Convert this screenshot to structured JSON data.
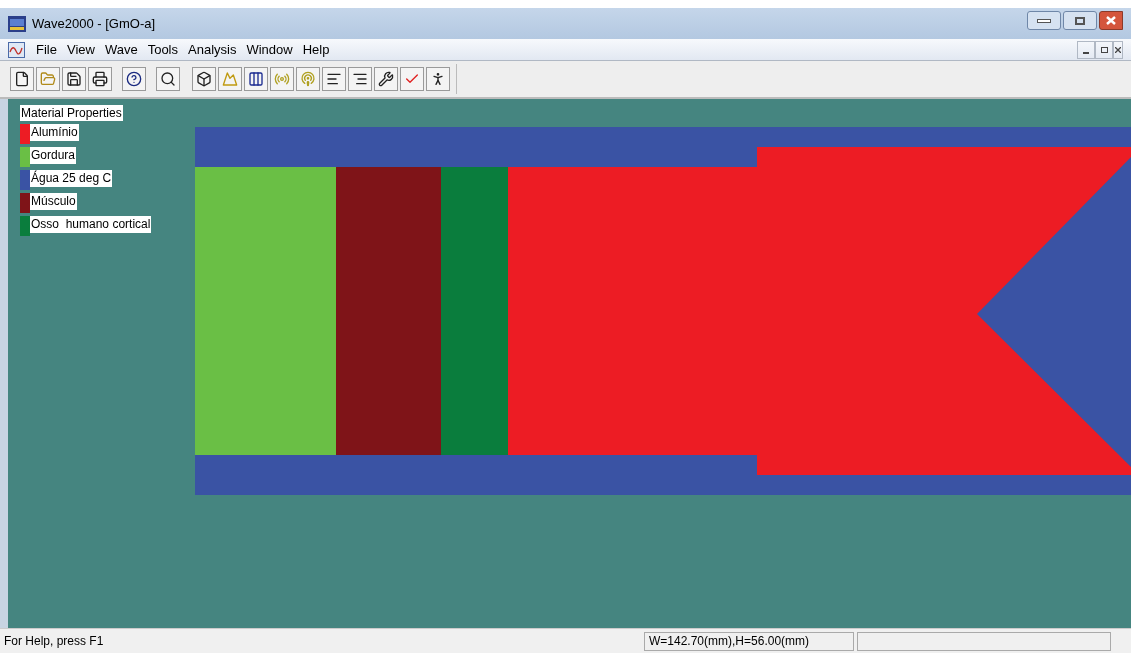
{
  "window": {
    "title": "Wave2000 - [GmO-a]"
  },
  "menu": [
    "File",
    "View",
    "Wave",
    "Tools",
    "Analysis",
    "Window",
    "Help"
  ],
  "legend": {
    "title": "Material Properties",
    "materials": [
      {
        "name": "Alumínio",
        "color": "#ed1c24"
      },
      {
        "name": "Gordura",
        "color": "#6abf45"
      },
      {
        "name": "Água 25 deg C",
        "color": "#3a53a4"
      },
      {
        "name": "Músculo",
        "color": "#7f1418"
      },
      {
        "name": "Osso  humano cortical",
        "color": "#0a7d3d"
      }
    ]
  },
  "status_bar": {
    "help": "For Help, press F1",
    "dimensions": "W=142.70(mm),H=56.00(mm)"
  }
}
